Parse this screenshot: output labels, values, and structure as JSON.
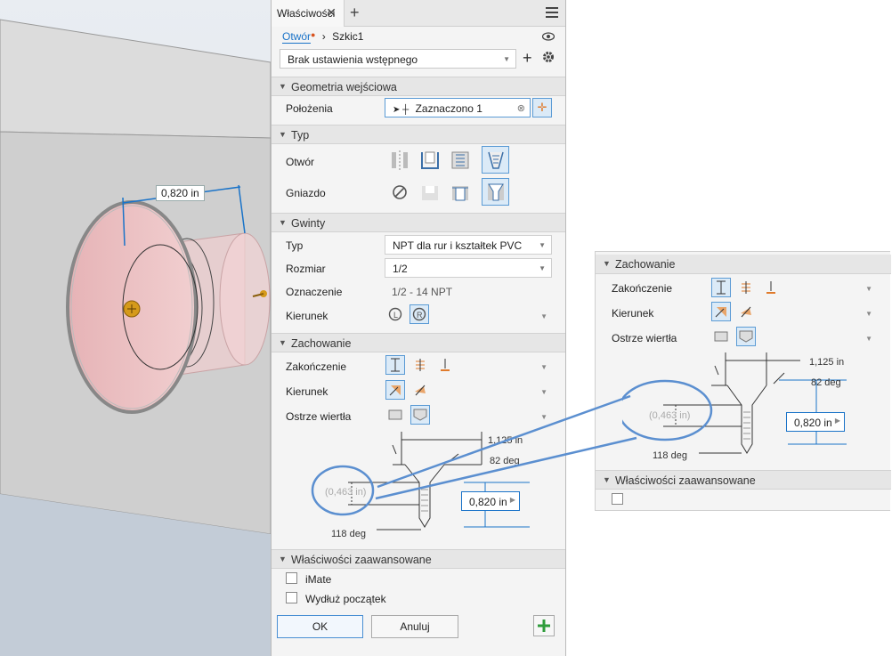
{
  "viewport": {
    "dimension_value": "0,820 in"
  },
  "panel": {
    "tab_title": "Właściwości",
    "breadcrumb": {
      "feature": "Otwór",
      "sketch": "Szkic1"
    },
    "preset": "Brak ustawienia wstępnego",
    "sections": {
      "input_geometry": "Geometria wejściowa",
      "type": "Typ",
      "threads": "Gwinty",
      "behavior": "Zachowanie",
      "advanced": "Właściwości zaawansowane"
    },
    "input_geometry": {
      "positions_label": "Położenia",
      "positions_value": "Zaznaczono 1"
    },
    "type": {
      "hole_label": "Otwór",
      "seat_label": "Gniazdo"
    },
    "threads": {
      "type_label": "Typ",
      "type_value": "NPT dla rur i kształtek PVC",
      "size_label": "Rozmiar",
      "size_value": "1/2",
      "designation_label": "Oznaczenie",
      "designation_value": "1/2 - 14 NPT",
      "direction_label": "Kierunek"
    },
    "behavior": {
      "termination_label": "Zakończenie",
      "direction_label": "Kierunek",
      "drill_point_label": "Ostrze wiertła"
    },
    "diagram": {
      "diameter": "1,125 in",
      "countersink_angle": "82 deg",
      "depth_ref": "(0,463 in)",
      "depth_value": "0,820 in",
      "drill_angle": "118 deg"
    },
    "advanced": {
      "imate_label": "iMate",
      "extend_label": "Wydłuż początek"
    },
    "buttons": {
      "ok": "OK",
      "cancel": "Anuluj"
    }
  },
  "zoom": {
    "section_behavior": "Zachowanie",
    "termination_label": "Zakończenie",
    "direction_label": "Kierunek",
    "drill_point_label": "Ostrze wiertła",
    "diameter": "1,125 in",
    "countersink_angle": "82 deg",
    "depth_ref": "(0,463 in)",
    "depth_value": "0,820 in",
    "drill_angle": "118 deg",
    "section_advanced": "Właściwości zaawansowane"
  },
  "colors": {
    "accent": "#1a73c8",
    "highlight": "#5b8fd0",
    "orange": "#e07b2c",
    "selected_bg": "#dbeaf7"
  }
}
